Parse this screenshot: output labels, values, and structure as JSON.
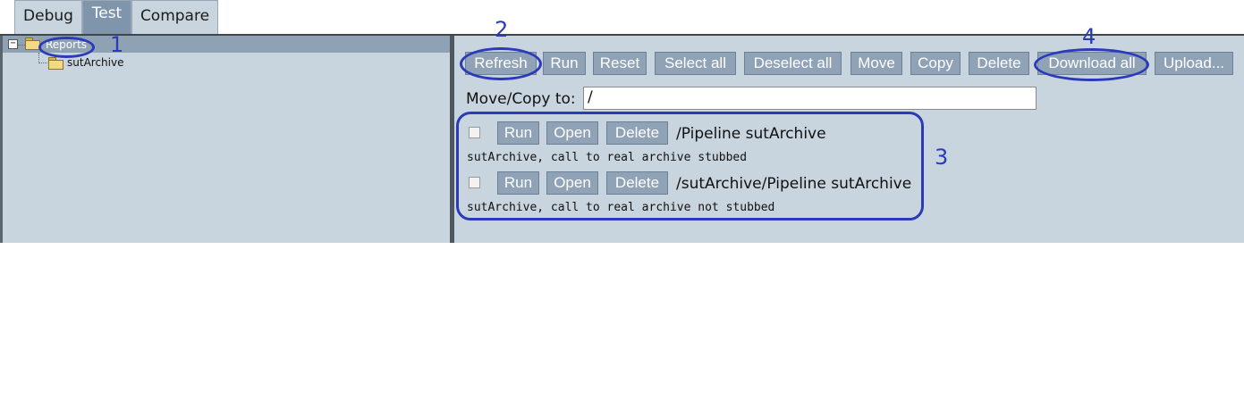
{
  "tabs": [
    "Debug",
    "Test",
    "Compare"
  ],
  "tree": {
    "toggle": "−",
    "root": "Reports",
    "child": "sutArchive"
  },
  "toolbar": {
    "refresh": "Refresh",
    "run": "Run",
    "reset": "Reset",
    "select_all": "Select all",
    "deselect_all": "Deselect all",
    "move": "Move",
    "copy": "Copy",
    "delete": "Delete",
    "download_all": "Download all",
    "upload": "Upload..."
  },
  "move_copy": {
    "label": "Move/Copy to:",
    "value": "/"
  },
  "reports": [
    {
      "run": "Run",
      "open": "Open",
      "delete": "Delete",
      "name": "/Pipeline sutArchive",
      "description": "sutArchive, call to real archive stubbed",
      "checked": false
    },
    {
      "run": "Run",
      "open": "Open",
      "delete": "Delete",
      "name": "/sutArchive/Pipeline sutArchive",
      "description": "sutArchive, call to real archive not stubbed",
      "checked": false
    }
  ],
  "annotations": [
    "1",
    "2",
    "3",
    "4"
  ],
  "colors": {
    "annotation": "#2b3ab8",
    "button": "#8fa2b6",
    "panel": "#c9d5de",
    "active_tab": "#7f95ab"
  }
}
